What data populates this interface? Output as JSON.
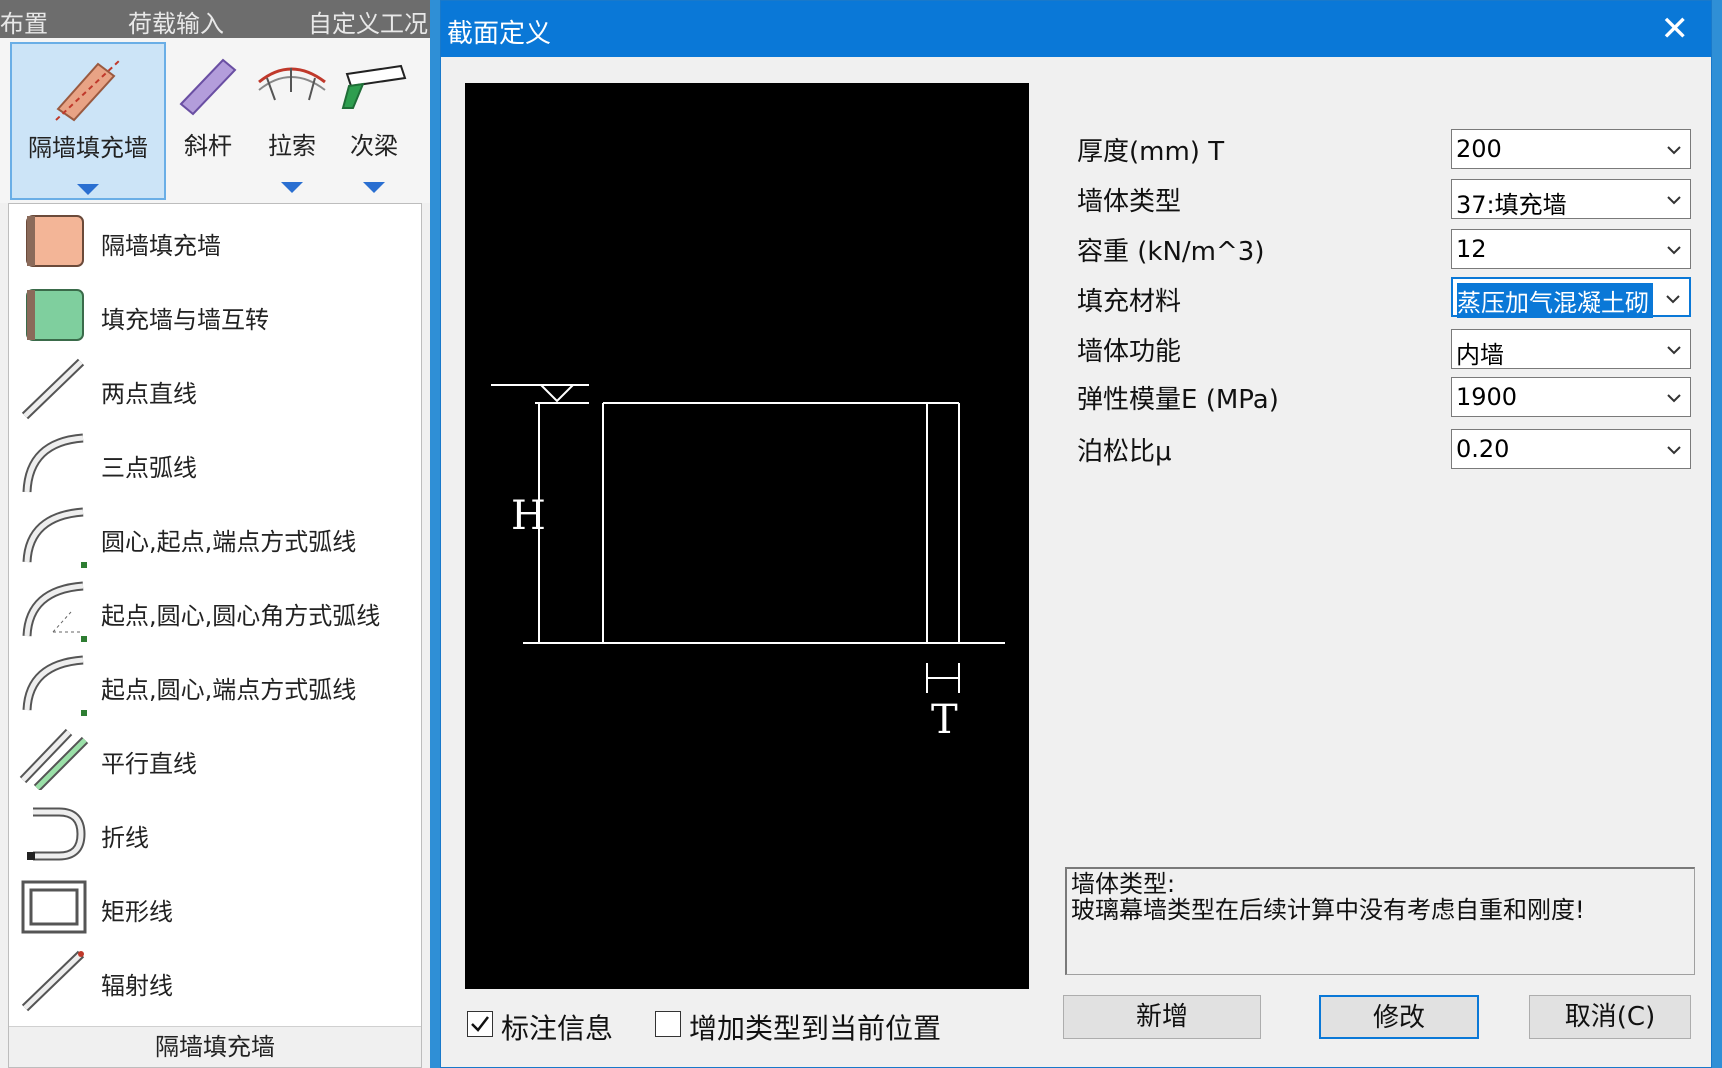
{
  "menubar": {
    "items": [
      "布置",
      "荷载输入",
      "自定义工况"
    ]
  },
  "ribbon": {
    "buttons": [
      {
        "label": "隔墙填充墙",
        "icon": "partition-wall-icon"
      },
      {
        "label": "斜杆",
        "icon": "diagonal-bar-icon"
      },
      {
        "label": "拉索",
        "icon": "cable-icon"
      },
      {
        "label": "次梁",
        "icon": "secondary-beam-icon"
      }
    ]
  },
  "dropdown": {
    "items": [
      {
        "label": "隔墙填充墙",
        "icon": "partition-wall-block-icon"
      },
      {
        "label": "填充墙与墙互转",
        "icon": "wall-convert-icon"
      },
      {
        "label": "两点直线",
        "icon": "two-point-line-icon"
      },
      {
        "label": "三点弧线",
        "icon": "three-point-arc-icon"
      },
      {
        "label": "圆心,起点,端点方式弧线",
        "icon": "center-start-end-arc-icon"
      },
      {
        "label": "起点,圆心,圆心角方式弧线",
        "icon": "start-center-angle-arc-icon"
      },
      {
        "label": "起点,圆心,端点方式弧线",
        "icon": "start-center-end-arc-icon"
      },
      {
        "label": "平行直线",
        "icon": "parallel-line-icon"
      },
      {
        "label": "折线",
        "icon": "polyline-icon"
      },
      {
        "label": "矩形线",
        "icon": "rectangle-line-icon"
      },
      {
        "label": "辐射线",
        "icon": "radial-line-icon"
      }
    ],
    "footer": "隔墙填充墙"
  },
  "dialog": {
    "title": "截面定义",
    "close_glyph": "✕",
    "preview": {
      "label_h": "H",
      "label_t": "T"
    },
    "fields": [
      {
        "label": "厚度(mm) T",
        "value": "200"
      },
      {
        "label": "墙体类型",
        "value": "37:填充墙"
      },
      {
        "label": "容重 (kN/m^3)",
        "value": "12"
      },
      {
        "label": "填充材料",
        "value": "蒸压加气混凝土砌"
      },
      {
        "label": "墙体功能",
        "value": "内墙"
      },
      {
        "label": "弹性模量E (MPa)",
        "value": "1900"
      },
      {
        "label": "泊松比μ",
        "value": "0.20"
      }
    ],
    "info": {
      "line1": "墙体类型:",
      "line2": "玻璃幕墙类型在后续计算中没有考虑自重和刚度!"
    },
    "checkboxes": [
      {
        "label": "标注信息",
        "checked": true
      },
      {
        "label": "增加类型到当前位置",
        "checked": false
      }
    ],
    "buttons": {
      "add": "新增",
      "modify": "修改",
      "cancel": "取消(C)"
    }
  }
}
